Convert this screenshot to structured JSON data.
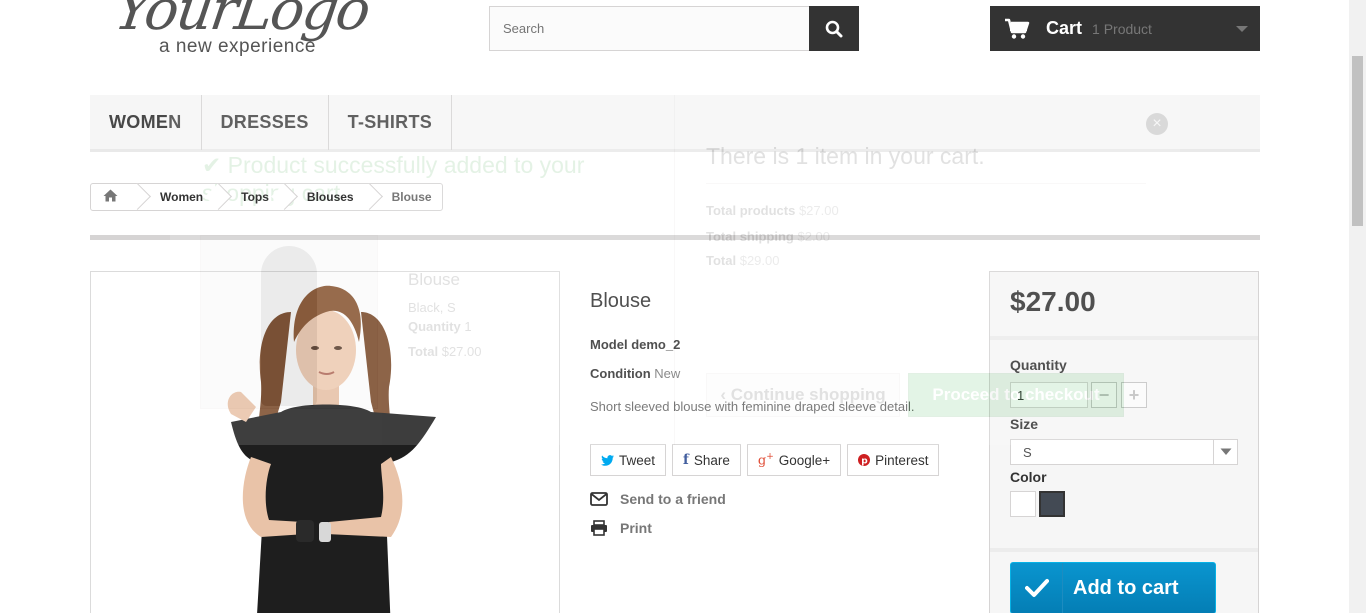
{
  "header": {
    "logo_title": "YourLogo",
    "logo_tagline": "a new experience",
    "search_placeholder": "Search",
    "cart_label": "Cart",
    "cart_count": "1 Product"
  },
  "menu": {
    "items": [
      {
        "label": "WOMEN"
      },
      {
        "label": "DRESSES"
      },
      {
        "label": "T-SHIRTS"
      }
    ]
  },
  "breadcrumb": {
    "items": [
      "Women",
      "Tops",
      "Blouses",
      "Blouse"
    ]
  },
  "product": {
    "name": "Blouse",
    "model_label": "Model",
    "model_value": "demo_2",
    "condition_label": "Condition",
    "condition_value": "New",
    "description": "Short sleeved blouse with feminine draped sleeve detail.",
    "share": {
      "tweet": "Tweet",
      "share": "Share",
      "google": "Google+",
      "pinterest": "Pinterest"
    },
    "send_to_friend": "Send to a friend",
    "print": "Print"
  },
  "buy_box": {
    "price": "$27.00",
    "quantity_label": "Quantity",
    "quantity_value": "1",
    "size_label": "Size",
    "size_value": "S",
    "color_label": "Color",
    "colors": [
      "#ffffff",
      "#434a54"
    ],
    "add_to_cart": "Add to cart"
  },
  "cart_layer": {
    "success_message": "Product successfully added to your shopping cart",
    "product_name": "Blouse",
    "product_attributes": "Black, S",
    "quantity_label": "Quantity",
    "quantity_value": "1",
    "total_label": "Total",
    "total_value": "$27.00",
    "cart_heading": "There is 1 item in your cart.",
    "total_products_label": "Total products",
    "total_products_value": "$27.00",
    "total_shipping_label": "Total shipping",
    "total_shipping_value": "$2.00",
    "grand_total_label": "Total",
    "grand_total_value": "$29.00",
    "continue_label": "Continue shopping",
    "checkout_label": "Proceed to checkout"
  },
  "colors": {
    "dark": "#333333",
    "accent_blue": "#0a95cf",
    "success_green": "#46a74e"
  }
}
